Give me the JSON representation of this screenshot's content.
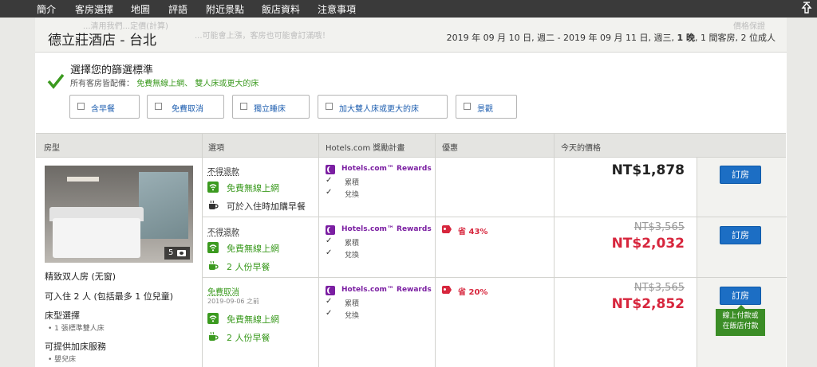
{
  "nav": {
    "tabs": [
      {
        "label": "簡介"
      },
      {
        "label": "客房選擇"
      },
      {
        "label": "地圖"
      },
      {
        "label": "評語"
      },
      {
        "label": "附近景點"
      },
      {
        "label": "飯店資料"
      },
      {
        "label": "注意事項"
      }
    ],
    "active_tab": "客房選擇"
  },
  "hotel": {
    "name": "德立莊酒店 - 台北",
    "ghost_left": "...清用我們...定價(計算)",
    "ghost_left2": "...可能會上漲，客房也可能會訂滿哦！",
    "ghost_right": "價格保證",
    "dates_prefix": "2019 年 09 月 10 日, 週二 - 2019 年 09 月 11 日, 週三, ",
    "nights": "1 晚",
    "sep": ", ",
    "rooms": "1 間客房",
    "sep2": ", ",
    "adults": "2 位成人"
  },
  "filters": {
    "title": "選擇您的篩選標準",
    "sub_prefix": "所有客房皆配備：",
    "sub_green": "免費無線上網、 雙人床或更大的床",
    "options": [
      {
        "label": "含早餐"
      },
      {
        "label": "免費取消"
      },
      {
        "label": "獨立睡床"
      },
      {
        "label": "加大雙人床或更大的床"
      },
      {
        "label": "景觀"
      }
    ]
  },
  "table": {
    "headers": {
      "room_type": "房型",
      "options": "選項",
      "rewards": "Hotels.com 獎勵計畫",
      "deals": "優惠",
      "price": "今天的價格"
    }
  },
  "room": {
    "photo_count": "5",
    "name": "精致双人房 (无窗)",
    "occupancy": "可入住 2 人 (包括最多 1 位兒童)",
    "bed_heading": "床型選擇",
    "bed_item": "1 張標準雙人床",
    "extra_heading": "可提供加床服務",
    "extra_item": "嬰兒床"
  },
  "rates": [
    {
      "policy": "不得退款",
      "wifi": "免費無線上網",
      "meal": "可於入住時加購早餐",
      "rewards_title": "Hotels.com™ Rewards",
      "collect": "累積",
      "redeem": "兌換",
      "price": "NT$1,878",
      "book": "訂房"
    },
    {
      "policy": "不得退款",
      "wifi": "免費無線上網",
      "meal": "2 人份早餐",
      "rewards_title": "Hotels.com™ Rewards",
      "collect": "累積",
      "redeem": "兌換",
      "deal": "省 43%",
      "old_price": "NT$3,565",
      "price": "NT$2,032",
      "book": "訂房"
    },
    {
      "policy": "免費取消",
      "policy_date": "2019-09-06 之前",
      "wifi": "免費無線上網",
      "meal": "2 人份早餐",
      "rewards_title": "Hotels.com™ Rewards",
      "collect": "累積",
      "redeem": "兌換",
      "deal": "省 20%",
      "old_price": "NT$3,565",
      "price": "NT$2,852",
      "book": "訂房",
      "pay_tip_line1": "線上付款或",
      "pay_tip_line2": "在飯店付款"
    }
  ],
  "colors": {
    "accent_blue": "#1c6ec4",
    "green": "#3b9a1f",
    "deal_red": "#d7263d",
    "rewards_purple": "#7b1fa2"
  }
}
